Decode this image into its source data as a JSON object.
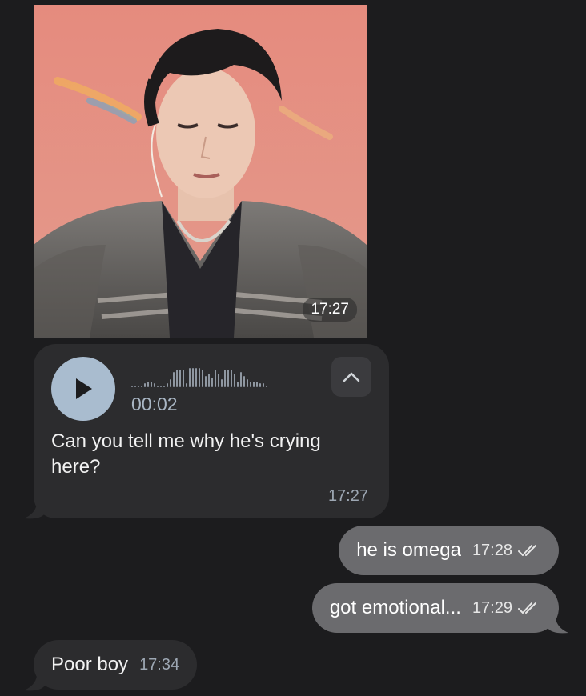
{
  "messages": {
    "photo": {
      "time": "17:27",
      "subject": "person-photo"
    },
    "voice": {
      "duration": "00:02",
      "transcript": "Can you tell me why he's crying here?",
      "time": "17:27",
      "waveform_levels": [
        0.1,
        0.1,
        0.1,
        0.1,
        0.2,
        0.3,
        0.3,
        0.2,
        0.1,
        0.1,
        0.1,
        0.2,
        0.4,
        0.8,
        0.9,
        0.9,
        0.9,
        0.2,
        1.0,
        1.0,
        1.0,
        1.0,
        0.9,
        0.6,
        0.7,
        0.5,
        0.9,
        0.7,
        0.4,
        0.9,
        0.9,
        0.9,
        0.7,
        0.3,
        0.8,
        0.6,
        0.4,
        0.3,
        0.3,
        0.3,
        0.2,
        0.2,
        0.1
      ]
    },
    "outgoing": [
      {
        "text": "he is omega",
        "time": "17:28",
        "status_icon": "double-check-icon"
      },
      {
        "text": "got emotional...",
        "time": "17:29",
        "status_icon": "double-check-icon"
      }
    ],
    "incoming_last": {
      "text": "Poor boy",
      "time": "17:34"
    }
  },
  "colors": {
    "background": "#1c1c1e",
    "incoming_bubble": "#2c2c2e",
    "outgoing_bubble": "#6b6b6e",
    "play_button": "#a9bccf"
  }
}
